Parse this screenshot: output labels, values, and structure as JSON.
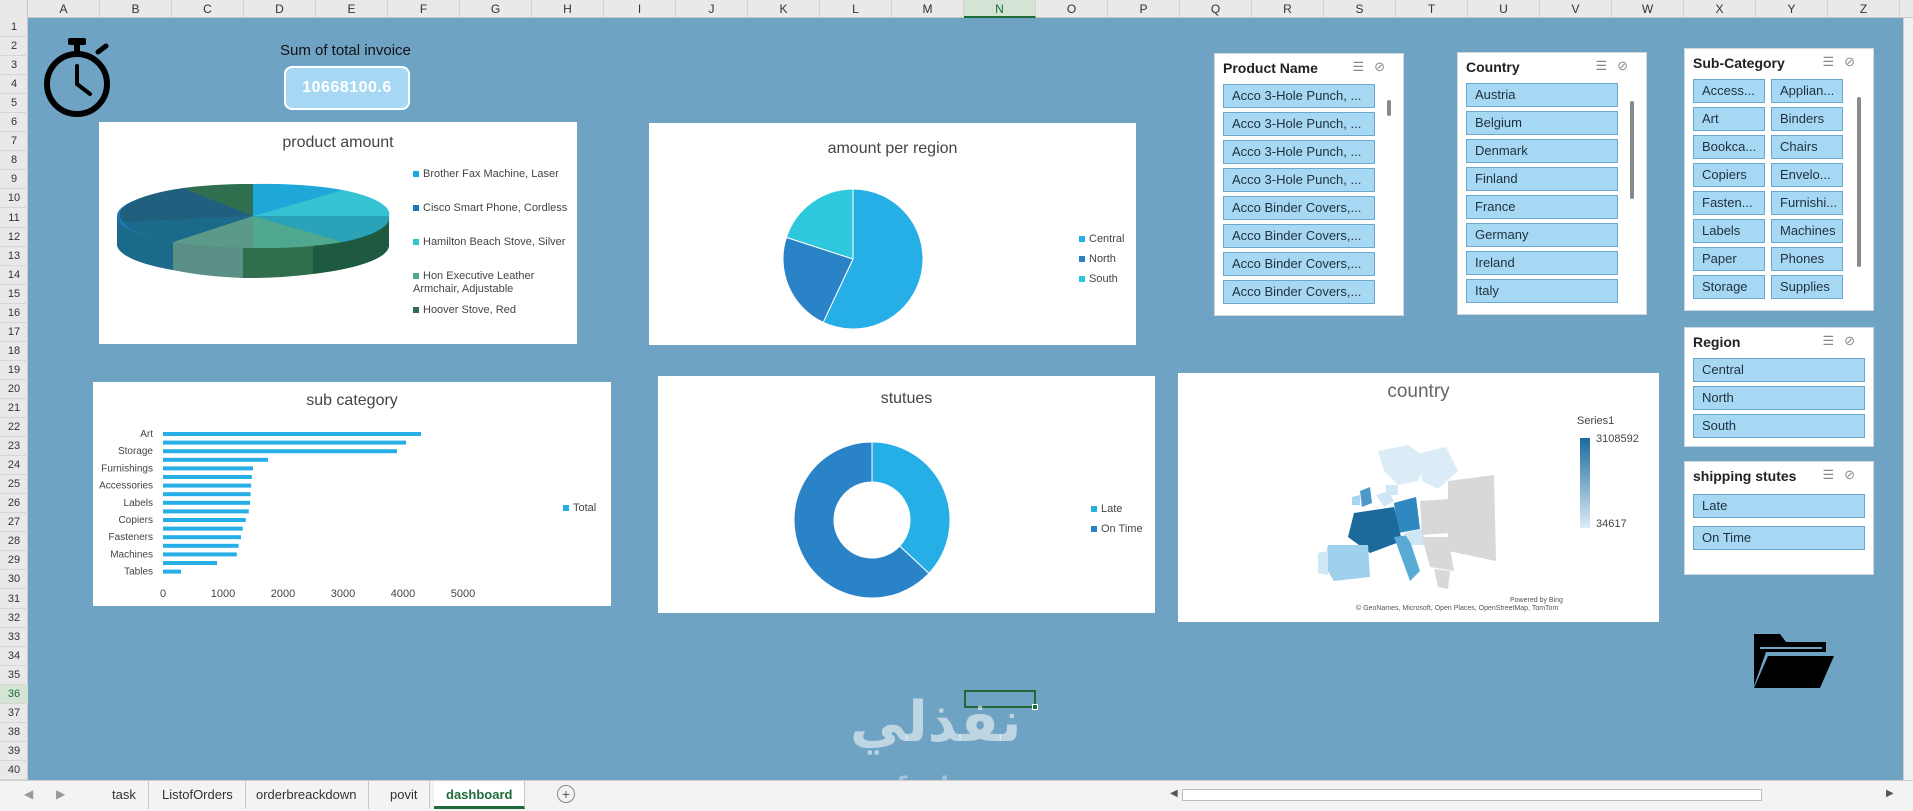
{
  "columns": [
    "A",
    "B",
    "C",
    "D",
    "E",
    "F",
    "G",
    "H",
    "I",
    "J",
    "K",
    "L",
    "M",
    "N",
    "O",
    "P",
    "Q",
    "R",
    "S",
    "T",
    "U",
    "V",
    "W",
    "X",
    "Y",
    "Z"
  ],
  "selected_column": "N",
  "rows": [
    "1",
    "2",
    "3",
    "4",
    "5",
    "6",
    "7",
    "8",
    "9",
    "10",
    "11",
    "12",
    "13",
    "14",
    "15",
    "16",
    "17",
    "18",
    "19",
    "20",
    "21",
    "22",
    "23",
    "24",
    "25",
    "26",
    "27",
    "28",
    "29",
    "30",
    "31",
    "32",
    "33",
    "34",
    "35",
    "36",
    "37",
    "38",
    "39",
    "40"
  ],
  "selected_row": "36",
  "invoice": {
    "title": "Sum of total invoice",
    "value": "10668100.6"
  },
  "charts": {
    "product_amount": {
      "title": "product amount",
      "legend": [
        "Brother Fax Machine, Laser",
        "Cisco Smart Phone, Cordless",
        "Hamilton Beach Stove, Silver",
        "Hon Executive Leather Armchair, Adjustable",
        "Hoover Stove, Red"
      ],
      "colors": [
        "#1fa7d9",
        "#1c7ab6",
        "#35c3d4",
        "#4fa88f",
        "#2f6f4e"
      ]
    },
    "amount_per_region": {
      "title": "amount per region",
      "legend": [
        "Central",
        "North",
        "South"
      ],
      "colors": [
        "#26aee6",
        "#2a82c7",
        "#2ec8de"
      ]
    },
    "sub_category": {
      "title": "sub category",
      "legend": [
        "Total"
      ],
      "ticks_x": [
        "0",
        "1000",
        "2000",
        "3000",
        "4000",
        "5000"
      ]
    },
    "stutues": {
      "title": "stutues",
      "legend": [
        "Late",
        "On Time"
      ],
      "colors": [
        "#26aee6",
        "#2a82c7"
      ]
    },
    "country": {
      "title": "country",
      "series_label": "Series1",
      "max_label": "3108592",
      "min_label": "34617",
      "powered": "Powered by Bing",
      "credits": "© GeoNames, Microsoft, Open Places, OpenStreetMap, TomTom"
    }
  },
  "chart_data": [
    {
      "type": "pie",
      "title": "product amount",
      "categories": [
        "Brother Fax Machine, Laser",
        "Cisco Smart Phone, Cordless",
        "Hamilton Beach Stove, Silver",
        "Hon Executive Leather Armchair, Adjustable",
        "Hoover Stove, Red"
      ]
    },
    {
      "type": "pie",
      "title": "amount per region",
      "categories": [
        "Central",
        "North",
        "South"
      ],
      "values": [
        57,
        23,
        20
      ]
    },
    {
      "type": "bar",
      "title": "sub category",
      "categories": [
        "Art",
        "",
        "Storage",
        "",
        "Furnishings",
        "",
        "Accessories",
        "",
        "Labels",
        "",
        "Copiers",
        "",
        "Fasteners",
        "",
        "Machines",
        "",
        "Tables"
      ],
      "values": [
        4300,
        4050,
        3900,
        1750,
        1500,
        1480,
        1470,
        1460,
        1450,
        1430,
        1380,
        1330,
        1300,
        1260,
        1230,
        900,
        300
      ],
      "series": [
        {
          "name": "Total"
        }
      ],
      "xlim": [
        0,
        5000
      ]
    },
    {
      "type": "pie",
      "title": "stutues",
      "categories": [
        "Late",
        "On Time"
      ],
      "values": [
        37,
        63
      ]
    }
  ],
  "slicers": {
    "product": {
      "title": "Product Name",
      "items": [
        "Acco 3-Hole Punch, ...",
        "Acco 3-Hole Punch, ...",
        "Acco 3-Hole Punch, ...",
        "Acco 3-Hole Punch, ...",
        "Acco Binder Covers,...",
        "Acco Binder Covers,...",
        "Acco Binder Covers,...",
        "Acco Binder Covers,..."
      ]
    },
    "country": {
      "title": "Country",
      "items": [
        "Austria",
        "Belgium",
        "Denmark",
        "Finland",
        "France",
        "Germany",
        "Ireland",
        "Italy"
      ]
    },
    "subcategory": {
      "title": "Sub-Category",
      "items": [
        "Access...",
        "Applian...",
        "Art",
        "Binders",
        "Bookca...",
        "Chairs",
        "Copiers",
        "Envelo...",
        "Fasten...",
        "Furnishi...",
        "Labels",
        "Machines",
        "Paper",
        "Phones",
        "Storage",
        "Supplies"
      ]
    },
    "region": {
      "title": "Region",
      "items": [
        "Central",
        "North",
        "South"
      ]
    },
    "shipping": {
      "title": "shipping stutes",
      "items": [
        "Late",
        "On Time"
      ]
    }
  },
  "tabs": [
    "task",
    "ListofOrders",
    "orderbreackdown",
    "povit",
    "dashboard"
  ],
  "active_tab": "dashboard",
  "watermark": {
    "arabic": "نفذلي",
    "latin": "nafezly.com"
  }
}
